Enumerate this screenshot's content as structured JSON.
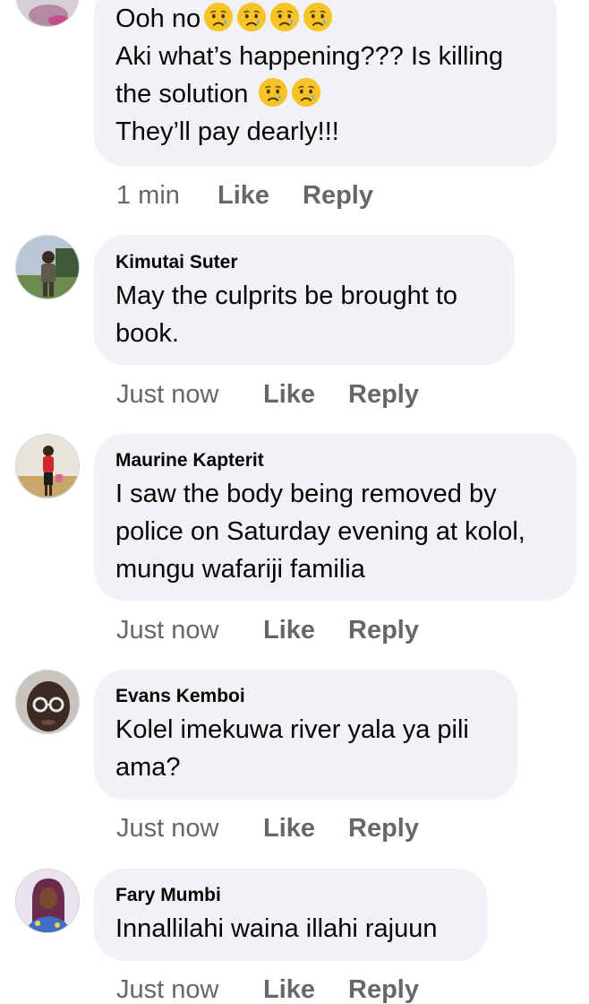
{
  "labels": {
    "like": "Like",
    "reply": "Reply"
  },
  "comments": [
    {
      "author": "",
      "avatar": "avatar-woman-cropped",
      "lines": [
        {
          "text": "Ooh no",
          "emojis": [
            "crying-face",
            "crying-face",
            "crying-face",
            "crying-face"
          ]
        },
        {
          "text": "Aki what’s happening??? Is killing"
        },
        {
          "text": "the solution ",
          "emojis": [
            "crying-face",
            "crying-face"
          ]
        },
        {
          "text": "They’ll pay dearly!!!"
        }
      ],
      "time": "1 min"
    },
    {
      "author": "Kimutai Suter",
      "avatar": "avatar-man-outdoors",
      "lines": [
        {
          "text": "May the culprits be brought to"
        },
        {
          "text": "book."
        }
      ],
      "time": "Just now"
    },
    {
      "author": "Maurine Kapterit",
      "avatar": "avatar-woman-red-top",
      "lines": [
        {
          "text": "I saw the body being removed by"
        },
        {
          "text": "police on Saturday evening at kolol,"
        },
        {
          "text": "mungu wafariji familia"
        }
      ],
      "time": "Just now"
    },
    {
      "author": "Evans Kemboi",
      "avatar": "avatar-man-glasses",
      "lines": [
        {
          "text": "Kolel imekuwa river yala ya pili"
        },
        {
          "text": "ama?"
        }
      ],
      "time": "Just now"
    },
    {
      "author": "Fary Mumbi",
      "avatar": "avatar-woman-hijab",
      "lines": [
        {
          "text": "Innallilahi waina illahi rajuun"
        }
      ],
      "time": "Just now"
    }
  ],
  "colors": {
    "bubble": "#f0f2f5",
    "meta_text": "#65676b",
    "body_text": "#050505",
    "emoji_face": "#f7c325"
  }
}
